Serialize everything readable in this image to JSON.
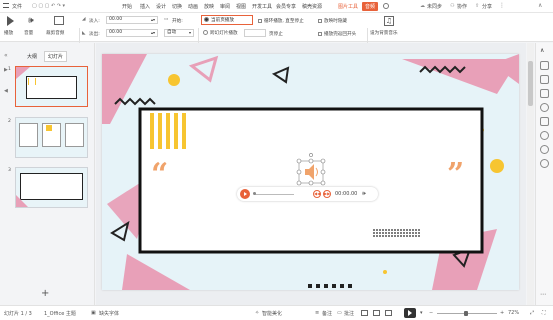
{
  "colors": {
    "accent": "#e8623a",
    "pink": "#e8a0b8",
    "yellow": "#f7c531",
    "teal": "#35a7c9",
    "lightblue": "#d6edf5"
  },
  "menubar": {
    "app_menu": "文件",
    "items": [
      "开始",
      "插入",
      "设计",
      "切换",
      "动画",
      "放映",
      "审阅",
      "视图",
      "开发工具",
      "会员专享",
      "稿壳资源",
      "图片工具",
      "音频"
    ],
    "active_item": "音频",
    "right": {
      "share_unsync": "未同步",
      "collab": "协作",
      "share": "分享"
    }
  },
  "ribbon": {
    "play_label": "播放",
    "volume_label": "音量",
    "trim_label": "裁剪音频",
    "fade_in_label": "淡入:",
    "fade_in_value": "00.00",
    "fade_out_label": "淡出:",
    "fade_out_value": "00.00",
    "start_label": "开始:",
    "start_value": "自动",
    "current_page_play": "当前页播放",
    "cross_page_play": "跨幻灯片播放",
    "loop_play": "循环播放, 直至停止",
    "hide_when_play": "放映时隐藏",
    "stop_at": "至",
    "page_stop": "页停止",
    "rewind": "播放完返回开头",
    "set_bg_music": "设为背景音乐"
  },
  "leftpanel": {
    "tab_outline": "大纲",
    "tab_slides": "幻灯片",
    "slide_numbers": [
      "1",
      "2",
      "3"
    ],
    "add_label": "+"
  },
  "player": {
    "time": "00:00.00"
  },
  "statusbar": {
    "slide_info": "幻灯片 1 / 3",
    "theme": "1_Office 主题",
    "missing_font": "缺失字体",
    "smart_beautify": "智能美化",
    "notes": "备注",
    "comments": "批注",
    "zoom": "72%"
  }
}
